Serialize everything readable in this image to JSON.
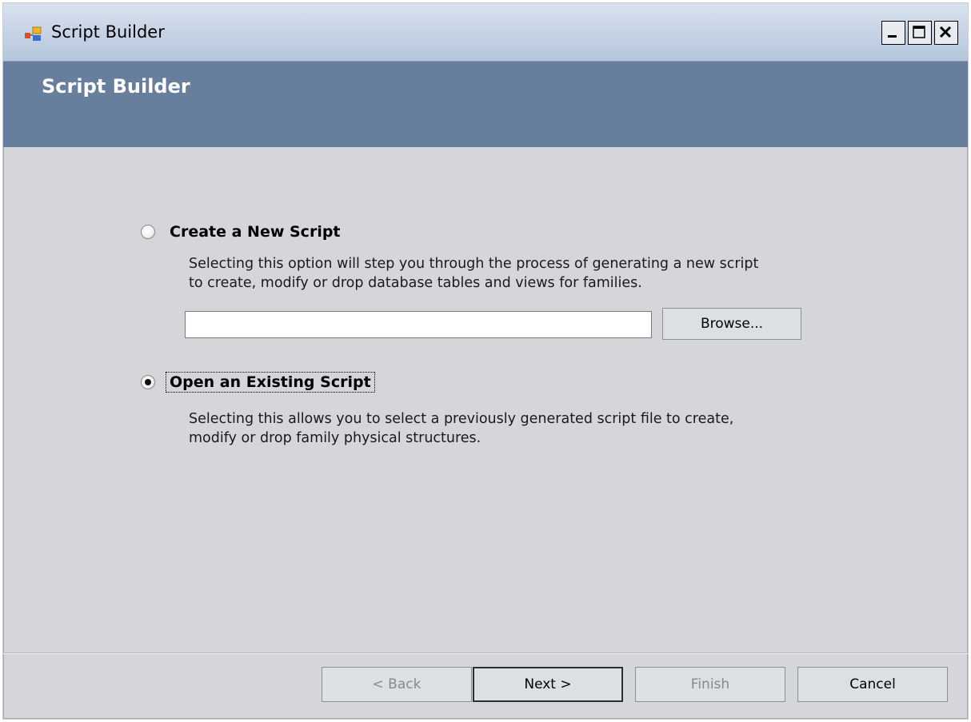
{
  "window": {
    "title": "Script Builder",
    "controls": {
      "minimize_icon": "minimize-icon",
      "maximize_icon": "maximize-icon",
      "close_icon": "close-icon"
    }
  },
  "header": {
    "title": "Script Builder",
    "band_color": "#677f9c"
  },
  "options": [
    {
      "label": "Create a New Script",
      "selected": false,
      "description_lines": [
        "Selecting this option will step you through the process of generating a new script",
        "to create, modify or drop database tables and views for families."
      ]
    },
    {
      "label": "Open an Existing Script",
      "selected": true,
      "description_lines": [
        "Selecting this allows you to select a previously generated script file to create,",
        "modify or drop family physical structures."
      ]
    }
  ],
  "file_path": {
    "value": "",
    "placeholder": ""
  },
  "browse_label": "Browse...",
  "footer": {
    "back_label": "< Back",
    "next_label": "Next >",
    "finish_label": "Finish",
    "cancel_label": "Cancel"
  }
}
